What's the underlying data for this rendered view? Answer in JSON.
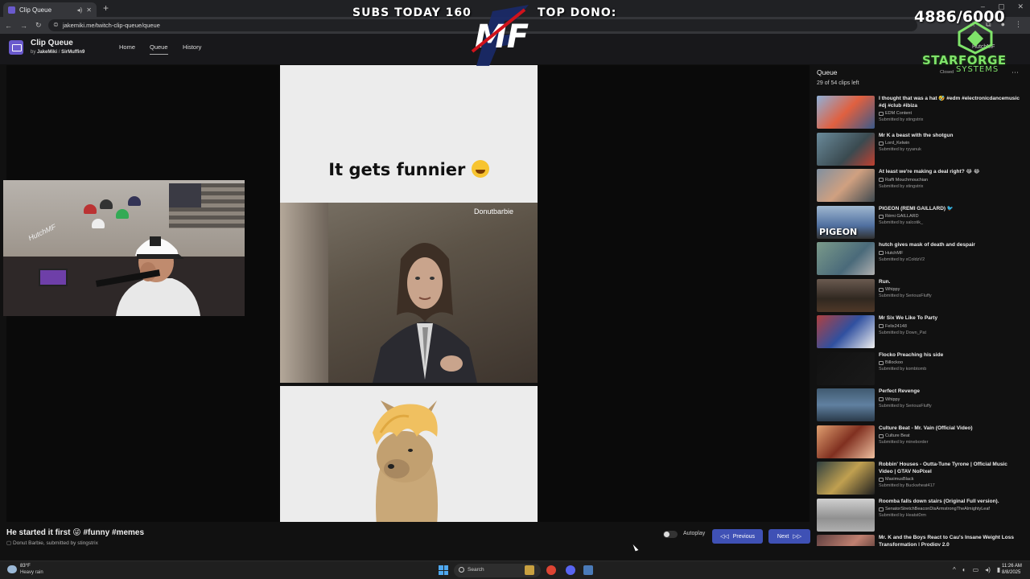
{
  "browser": {
    "tab_title": "Clip Queue",
    "url": "jakemiki.me/twitch-clip-queue/queue"
  },
  "overlay": {
    "subs_today": "SUBS TODAY 160",
    "top_dono": "TOP DONO:",
    "logo_text": "MF",
    "goal": "4886/6000",
    "sponsor_name": "STARFORGE",
    "sponsor_sub": "SYSTEMS"
  },
  "app": {
    "title": "Clip Queue",
    "by_prefix": "by",
    "author1": "JakeMiki",
    "separator": "/",
    "author2": "SirMuffin9",
    "nav": [
      "Home",
      "Queue",
      "History"
    ],
    "user": "HutchMF",
    "status": "Closed"
  },
  "current_clip": {
    "caption": "It gets funnier",
    "watermark": "Donutbarbie",
    "title": "He started it first 😜 #funny #memes",
    "channel": "Donut Barbie",
    "submitted": ", submitted by stingstrix"
  },
  "webcam": {
    "sign": "HutchMF"
  },
  "controls": {
    "autoplay_label": "Autoplay",
    "autoplay_on": false,
    "previous_label": "Previous",
    "next_label": "Next"
  },
  "queue": {
    "title": "Queue",
    "count": "29 of 54 clips left",
    "items": [
      {
        "title": "I thought that was a hat 🤣 #edm #electronicdancemusic #dj #club #ibiza",
        "channel": "EDM Content",
        "submitted": "Submitted by stingstrix"
      },
      {
        "title": "Mr K a beast with the shotgun",
        "channel": "Lord_Kelwin",
        "submitted": "Submitted by ryyanuk"
      },
      {
        "title": "At least we're making a deal right? 😂 😂",
        "channel": "Raffi Mouchmouchian",
        "submitted": "Submitted by stingstrix"
      },
      {
        "title": "PIGEON (REMI GAILLARD) 🐦",
        "channel": "Rémi GAILLARD",
        "submitted": "Submitted by salcotik_"
      },
      {
        "title": "hutch gives mask of death and despair",
        "channel": "HutchMF",
        "submitted": "Submitted by xColdzV2"
      },
      {
        "title": "Run.",
        "channel": "Whippy",
        "submitted": "Submitted by SeriousFluffy"
      },
      {
        "title": "Mr Six We Like To Party",
        "channel": "Felix24148",
        "submitted": "Submitted by Down_Pat"
      },
      {
        "title": "Flocko Preaching his side",
        "channel": "Billockoo",
        "submitted": "Submitted by kombtomb"
      },
      {
        "title": "Perfect Revenge",
        "channel": "Whippy",
        "submitted": "Submitted by SeriousFluffy"
      },
      {
        "title": "Culture Beat - Mr. Vain (Official Video)",
        "channel": "Culture Beat",
        "submitted": "Submitted by mineborder"
      },
      {
        "title": "Robbin' Houses - Outta-Tune Tyrone | Official Music Video | GTAV NoPixel",
        "channel": "MaximusBlack",
        "submitted": "Submitted by Buckwheat417"
      },
      {
        "title": "Roomba falls down stairs (Original Full version).",
        "channel": "SenatorStretchBeaconDisArmstrongTheAlmightyLeaf",
        "submitted": "Submitted by Heatst0rm"
      },
      {
        "title": "Mr. K and the Boys React to Cau's Insane Weight Loss Transformation | Prodigy 2.0",
        "channel": "",
        "submitted": ""
      }
    ],
    "thumb_labels": {
      "pigeon": "PIGEON"
    }
  },
  "taskbar": {
    "temp": "83°F",
    "weather": "Heavy rain",
    "search": "Search",
    "time": "11:26 AM",
    "date": "8/8/2025"
  }
}
